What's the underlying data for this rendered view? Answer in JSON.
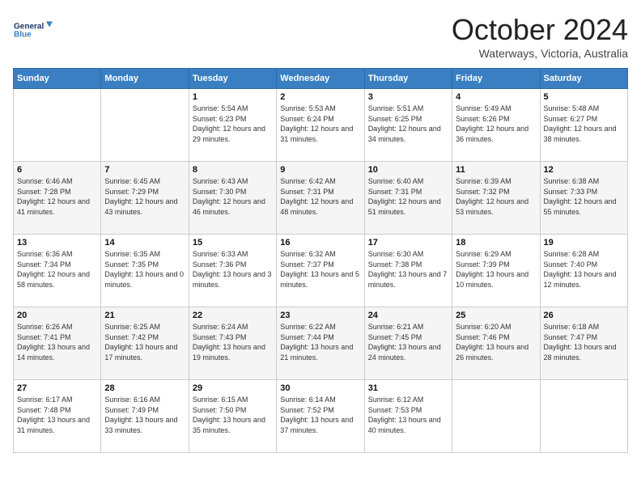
{
  "header": {
    "logo_line1": "General",
    "logo_line2": "Blue",
    "month_title": "October 2024",
    "location": "Waterways, Victoria, Australia"
  },
  "days_of_week": [
    "Sunday",
    "Monday",
    "Tuesday",
    "Wednesday",
    "Thursday",
    "Friday",
    "Saturday"
  ],
  "weeks": [
    [
      {
        "day": "",
        "sunrise": "",
        "sunset": "",
        "daylight": ""
      },
      {
        "day": "",
        "sunrise": "",
        "sunset": "",
        "daylight": ""
      },
      {
        "day": "1",
        "sunrise": "Sunrise: 5:54 AM",
        "sunset": "Sunset: 6:23 PM",
        "daylight": "Daylight: 12 hours and 29 minutes."
      },
      {
        "day": "2",
        "sunrise": "Sunrise: 5:53 AM",
        "sunset": "Sunset: 6:24 PM",
        "daylight": "Daylight: 12 hours and 31 minutes."
      },
      {
        "day": "3",
        "sunrise": "Sunrise: 5:51 AM",
        "sunset": "Sunset: 6:25 PM",
        "daylight": "Daylight: 12 hours and 34 minutes."
      },
      {
        "day": "4",
        "sunrise": "Sunrise: 5:49 AM",
        "sunset": "Sunset: 6:26 PM",
        "daylight": "Daylight: 12 hours and 36 minutes."
      },
      {
        "day": "5",
        "sunrise": "Sunrise: 5:48 AM",
        "sunset": "Sunset: 6:27 PM",
        "daylight": "Daylight: 12 hours and 38 minutes."
      }
    ],
    [
      {
        "day": "6",
        "sunrise": "Sunrise: 6:46 AM",
        "sunset": "Sunset: 7:28 PM",
        "daylight": "Daylight: 12 hours and 41 minutes."
      },
      {
        "day": "7",
        "sunrise": "Sunrise: 6:45 AM",
        "sunset": "Sunset: 7:29 PM",
        "daylight": "Daylight: 12 hours and 43 minutes."
      },
      {
        "day": "8",
        "sunrise": "Sunrise: 6:43 AM",
        "sunset": "Sunset: 7:30 PM",
        "daylight": "Daylight: 12 hours and 46 minutes."
      },
      {
        "day": "9",
        "sunrise": "Sunrise: 6:42 AM",
        "sunset": "Sunset: 7:31 PM",
        "daylight": "Daylight: 12 hours and 48 minutes."
      },
      {
        "day": "10",
        "sunrise": "Sunrise: 6:40 AM",
        "sunset": "Sunset: 7:31 PM",
        "daylight": "Daylight: 12 hours and 51 minutes."
      },
      {
        "day": "11",
        "sunrise": "Sunrise: 6:39 AM",
        "sunset": "Sunset: 7:32 PM",
        "daylight": "Daylight: 12 hours and 53 minutes."
      },
      {
        "day": "12",
        "sunrise": "Sunrise: 6:38 AM",
        "sunset": "Sunset: 7:33 PM",
        "daylight": "Daylight: 12 hours and 55 minutes."
      }
    ],
    [
      {
        "day": "13",
        "sunrise": "Sunrise: 6:36 AM",
        "sunset": "Sunset: 7:34 PM",
        "daylight": "Daylight: 12 hours and 58 minutes."
      },
      {
        "day": "14",
        "sunrise": "Sunrise: 6:35 AM",
        "sunset": "Sunset: 7:35 PM",
        "daylight": "Daylight: 13 hours and 0 minutes."
      },
      {
        "day": "15",
        "sunrise": "Sunrise: 6:33 AM",
        "sunset": "Sunset: 7:36 PM",
        "daylight": "Daylight: 13 hours and 3 minutes."
      },
      {
        "day": "16",
        "sunrise": "Sunrise: 6:32 AM",
        "sunset": "Sunset: 7:37 PM",
        "daylight": "Daylight: 13 hours and 5 minutes."
      },
      {
        "day": "17",
        "sunrise": "Sunrise: 6:30 AM",
        "sunset": "Sunset: 7:38 PM",
        "daylight": "Daylight: 13 hours and 7 minutes."
      },
      {
        "day": "18",
        "sunrise": "Sunrise: 6:29 AM",
        "sunset": "Sunset: 7:39 PM",
        "daylight": "Daylight: 13 hours and 10 minutes."
      },
      {
        "day": "19",
        "sunrise": "Sunrise: 6:28 AM",
        "sunset": "Sunset: 7:40 PM",
        "daylight": "Daylight: 13 hours and 12 minutes."
      }
    ],
    [
      {
        "day": "20",
        "sunrise": "Sunrise: 6:26 AM",
        "sunset": "Sunset: 7:41 PM",
        "daylight": "Daylight: 13 hours and 14 minutes."
      },
      {
        "day": "21",
        "sunrise": "Sunrise: 6:25 AM",
        "sunset": "Sunset: 7:42 PM",
        "daylight": "Daylight: 13 hours and 17 minutes."
      },
      {
        "day": "22",
        "sunrise": "Sunrise: 6:24 AM",
        "sunset": "Sunset: 7:43 PM",
        "daylight": "Daylight: 13 hours and 19 minutes."
      },
      {
        "day": "23",
        "sunrise": "Sunrise: 6:22 AM",
        "sunset": "Sunset: 7:44 PM",
        "daylight": "Daylight: 13 hours and 21 minutes."
      },
      {
        "day": "24",
        "sunrise": "Sunrise: 6:21 AM",
        "sunset": "Sunset: 7:45 PM",
        "daylight": "Daylight: 13 hours and 24 minutes."
      },
      {
        "day": "25",
        "sunrise": "Sunrise: 6:20 AM",
        "sunset": "Sunset: 7:46 PM",
        "daylight": "Daylight: 13 hours and 26 minutes."
      },
      {
        "day": "26",
        "sunrise": "Sunrise: 6:18 AM",
        "sunset": "Sunset: 7:47 PM",
        "daylight": "Daylight: 13 hours and 28 minutes."
      }
    ],
    [
      {
        "day": "27",
        "sunrise": "Sunrise: 6:17 AM",
        "sunset": "Sunset: 7:48 PM",
        "daylight": "Daylight: 13 hours and 31 minutes."
      },
      {
        "day": "28",
        "sunrise": "Sunrise: 6:16 AM",
        "sunset": "Sunset: 7:49 PM",
        "daylight": "Daylight: 13 hours and 33 minutes."
      },
      {
        "day": "29",
        "sunrise": "Sunrise: 6:15 AM",
        "sunset": "Sunset: 7:50 PM",
        "daylight": "Daylight: 13 hours and 35 minutes."
      },
      {
        "day": "30",
        "sunrise": "Sunrise: 6:14 AM",
        "sunset": "Sunset: 7:52 PM",
        "daylight": "Daylight: 13 hours and 37 minutes."
      },
      {
        "day": "31",
        "sunrise": "Sunrise: 6:12 AM",
        "sunset": "Sunset: 7:53 PM",
        "daylight": "Daylight: 13 hours and 40 minutes."
      },
      {
        "day": "",
        "sunrise": "",
        "sunset": "",
        "daylight": ""
      },
      {
        "day": "",
        "sunrise": "",
        "sunset": "",
        "daylight": ""
      }
    ]
  ]
}
